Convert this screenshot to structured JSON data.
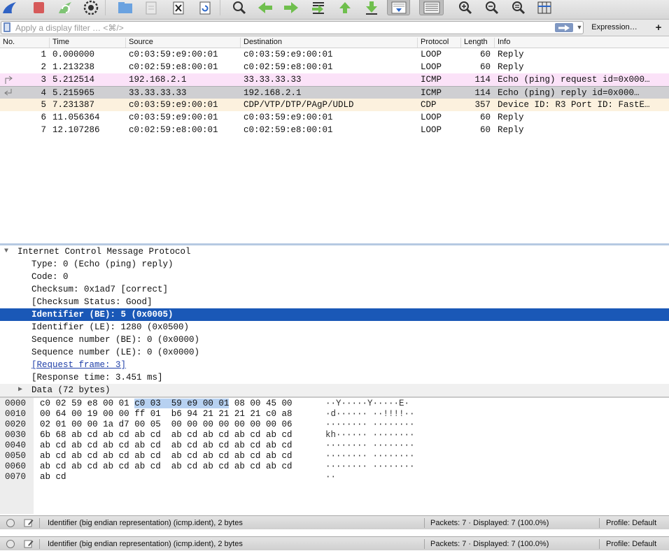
{
  "toolbar": {
    "buttons": [
      {
        "name": "shark-fin-start-button"
      },
      {
        "name": "stop-capture-button"
      },
      {
        "name": "restart-capture-button"
      },
      {
        "name": "capture-options-button"
      },
      {
        "name": "open-file-button"
      },
      {
        "name": "save-file-button"
      },
      {
        "name": "close-file-button"
      },
      {
        "name": "reload-file-button"
      },
      {
        "name": "find-packet-button"
      },
      {
        "name": "go-back-button"
      },
      {
        "name": "go-forward-button"
      },
      {
        "name": "go-to-packet-button"
      },
      {
        "name": "go-first-packet-button"
      },
      {
        "name": "go-last-packet-button"
      },
      {
        "name": "autoscroll-button"
      },
      {
        "name": "colorize-button"
      },
      {
        "name": "zoom-in-button"
      },
      {
        "name": "zoom-out-button"
      },
      {
        "name": "normal-size-button"
      },
      {
        "name": "resize-columns-button"
      }
    ]
  },
  "filter": {
    "placeholder": "Apply a display filter … <⌘/>",
    "value": "",
    "apply_icon": "arrow-right-icon",
    "dropdown_icon": "chevron-down-icon",
    "expression_label": "Expression…",
    "add_label": "+"
  },
  "packet_list": {
    "columns": [
      "No.",
      "Time",
      "Source",
      "Destination",
      "Protocol",
      "Length",
      "Info"
    ],
    "rows": [
      {
        "no": "1",
        "time": "0.000000",
        "source": "c0:03:59:e9:00:01",
        "destination": "c0:03:59:e9:00:01",
        "protocol": "LOOP",
        "length": "60",
        "info": "Reply",
        "color": "#ffffff"
      },
      {
        "no": "2",
        "time": "1.213238",
        "source": "c0:02:59:e8:00:01",
        "destination": "c0:02:59:e8:00:01",
        "protocol": "LOOP",
        "length": "60",
        "info": "Reply",
        "color": "#ffffff"
      },
      {
        "no": "3",
        "time": "5.212514",
        "source": "192.168.2.1",
        "destination": "33.33.33.33",
        "protocol": "ICMP",
        "length": "114",
        "info": "Echo (ping) request  id=0x000…",
        "color": "#fbe2f8"
      },
      {
        "no": "4",
        "time": "5.215965",
        "source": "33.33.33.33",
        "destination": "192.168.2.1",
        "protocol": "ICMP",
        "length": "114",
        "info": "Echo (ping) reply    id=0x000…",
        "color": "#cfcfd2"
      },
      {
        "no": "5",
        "time": "7.231387",
        "source": "c0:03:59:e9:00:01",
        "destination": "CDP/VTP/DTP/PAgP/UDLD",
        "protocol": "CDP",
        "length": "357",
        "info": "Device ID: R3  Port ID: FastE…",
        "color": "#fcf1de"
      },
      {
        "no": "6",
        "time": "11.056364",
        "source": "c0:03:59:e9:00:01",
        "destination": "c0:03:59:e9:00:01",
        "protocol": "LOOP",
        "length": "60",
        "info": "Reply",
        "color": "#ffffff"
      },
      {
        "no": "7",
        "time": "12.107286",
        "source": "c0:02:59:e8:00:01",
        "destination": "c0:02:59:e8:00:01",
        "protocol": "LOOP",
        "length": "60",
        "info": "Reply",
        "color": "#ffffff"
      }
    ]
  },
  "details": {
    "header": "Internet Control Message Protocol",
    "fields": [
      {
        "text": "Type: 0 (Echo (ping) reply)",
        "selected": false,
        "link": false
      },
      {
        "text": "Code: 0",
        "selected": false,
        "link": false
      },
      {
        "text": "Checksum: 0x1ad7 [correct]",
        "selected": false,
        "link": false
      },
      {
        "text": "[Checksum Status: Good]",
        "selected": false,
        "link": false
      },
      {
        "text": "Identifier (BE): 5 (0x0005)",
        "selected": true,
        "link": false
      },
      {
        "text": "Identifier (LE): 1280 (0x0500)",
        "selected": false,
        "link": false
      },
      {
        "text": "Sequence number (BE): 0 (0x0000)",
        "selected": false,
        "link": false
      },
      {
        "text": "Sequence number (LE): 0 (0x0000)",
        "selected": false,
        "link": false
      },
      {
        "text": "[Request frame: 3]",
        "selected": false,
        "link": true
      },
      {
        "text": "[Response time: 3.451 ms]",
        "selected": false,
        "link": false
      }
    ],
    "data_node": "Data (72 bytes)"
  },
  "bytes": {
    "rows": [
      {
        "offset": "0000",
        "hex": [
          "c0",
          "02",
          "59",
          "e8",
          "00",
          "01",
          "c0",
          "03",
          "59",
          "e9",
          "00",
          "01",
          "08",
          "00",
          "45",
          "00"
        ],
        "ascii": "··Y·····Y·····E·"
      },
      {
        "offset": "0010",
        "hex": [
          "00",
          "64",
          "00",
          "19",
          "00",
          "00",
          "ff",
          "01",
          "b6",
          "94",
          "21",
          "21",
          "21",
          "21",
          "c0",
          "a8"
        ],
        "ascii": "·d······ ··!!!!··"
      },
      {
        "offset": "0020",
        "hex": [
          "02",
          "01",
          "00",
          "00",
          "1a",
          "d7",
          "00",
          "05",
          "00",
          "00",
          "00",
          "00",
          "00",
          "00",
          "00",
          "06"
        ],
        "ascii": "········ ········"
      },
      {
        "offset": "0030",
        "hex": [
          "6b",
          "68",
          "ab",
          "cd",
          "ab",
          "cd",
          "ab",
          "cd",
          "ab",
          "cd",
          "ab",
          "cd",
          "ab",
          "cd",
          "ab",
          "cd"
        ],
        "ascii": "kh······ ········"
      },
      {
        "offset": "0040",
        "hex": [
          "ab",
          "cd",
          "ab",
          "cd",
          "ab",
          "cd",
          "ab",
          "cd",
          "ab",
          "cd",
          "ab",
          "cd",
          "ab",
          "cd",
          "ab",
          "cd"
        ],
        "ascii": "········ ········"
      },
      {
        "offset": "0050",
        "hex": [
          "ab",
          "cd",
          "ab",
          "cd",
          "ab",
          "cd",
          "ab",
          "cd",
          "ab",
          "cd",
          "ab",
          "cd",
          "ab",
          "cd",
          "ab",
          "cd"
        ],
        "ascii": "········ ········"
      },
      {
        "offset": "0060",
        "hex": [
          "ab",
          "cd",
          "ab",
          "cd",
          "ab",
          "cd",
          "ab",
          "cd",
          "ab",
          "cd",
          "ab",
          "cd",
          "ab",
          "cd",
          "ab",
          "cd"
        ],
        "ascii": "········ ········"
      },
      {
        "offset": "0070",
        "hex": [
          "ab",
          "cd"
        ],
        "ascii": "··"
      }
    ],
    "highlight_bytes": [
      6,
      7,
      8,
      9,
      10,
      11
    ]
  },
  "status_bars": [
    {
      "field": "Identifier (big endian representation) (icmp.ident), 2 bytes",
      "packets": "Packets: 7 · Displayed: 7 (100.0%)",
      "profile": "Profile: Default"
    },
    {
      "field": "Identifier (big endian representation) (icmp.ident), 2 bytes",
      "packets": "Packets: 7 · Displayed: 7 (100.0%)",
      "profile": "Profile: Default"
    }
  ],
  "colors": {
    "selection": "#1a58b7",
    "byte_highlight": "#b7d1f1",
    "icmp_request": "#fbe2f8",
    "icmp_reply_selected": "#cfcfd2",
    "cdp": "#fcf1de"
  }
}
